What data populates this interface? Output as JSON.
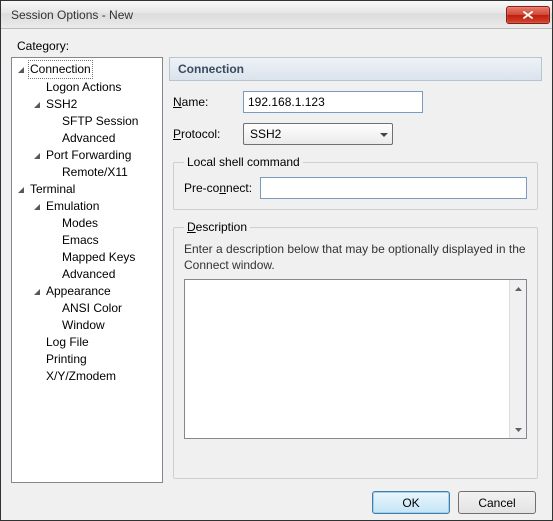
{
  "window": {
    "title": "Session Options - New"
  },
  "category_label": "Category:",
  "tree": {
    "items": [
      {
        "label": "Connection",
        "depth": 0,
        "expanded": true,
        "selected": true
      },
      {
        "label": "Logon Actions",
        "depth": 1,
        "leaf": true
      },
      {
        "label": "SSH2",
        "depth": 1,
        "expanded": true
      },
      {
        "label": "SFTP Session",
        "depth": 2,
        "leaf": true
      },
      {
        "label": "Advanced",
        "depth": 2,
        "leaf": true
      },
      {
        "label": "Port Forwarding",
        "depth": 1,
        "expanded": true
      },
      {
        "label": "Remote/X11",
        "depth": 2,
        "leaf": true
      },
      {
        "label": "Terminal",
        "depth": 0,
        "expanded": true
      },
      {
        "label": "Emulation",
        "depth": 1,
        "expanded": true
      },
      {
        "label": "Modes",
        "depth": 2,
        "leaf": true
      },
      {
        "label": "Emacs",
        "depth": 2,
        "leaf": true
      },
      {
        "label": "Mapped Keys",
        "depth": 2,
        "leaf": true
      },
      {
        "label": "Advanced",
        "depth": 2,
        "leaf": true
      },
      {
        "label": "Appearance",
        "depth": 1,
        "expanded": true
      },
      {
        "label": "ANSI Color",
        "depth": 2,
        "leaf": true
      },
      {
        "label": "Window",
        "depth": 2,
        "leaf": true
      },
      {
        "label": "Log File",
        "depth": 1,
        "leaf": true
      },
      {
        "label": "Printing",
        "depth": 1,
        "leaf": true
      },
      {
        "label": "X/Y/Zmodem",
        "depth": 1,
        "leaf": true
      }
    ]
  },
  "panel": {
    "header": "Connection",
    "name_label_pre": "N",
    "name_label_post": "ame:",
    "name_value": "192.168.1.123",
    "protocol_label_pre": "P",
    "protocol_label_post": "rotocol:",
    "protocol_value": "SSH2",
    "local_shell_legend": "Local shell command",
    "preconnect_pre": "Pre-co",
    "preconnect_post": "nect:",
    "preconnect_underline": "n",
    "preconnect_value": "",
    "description_legend_pre": "D",
    "description_legend_post": "escription",
    "description_help": "Enter a description below that may be optionally displayed in the Connect window.",
    "description_value": ""
  },
  "buttons": {
    "ok": "OK",
    "cancel": "Cancel"
  }
}
